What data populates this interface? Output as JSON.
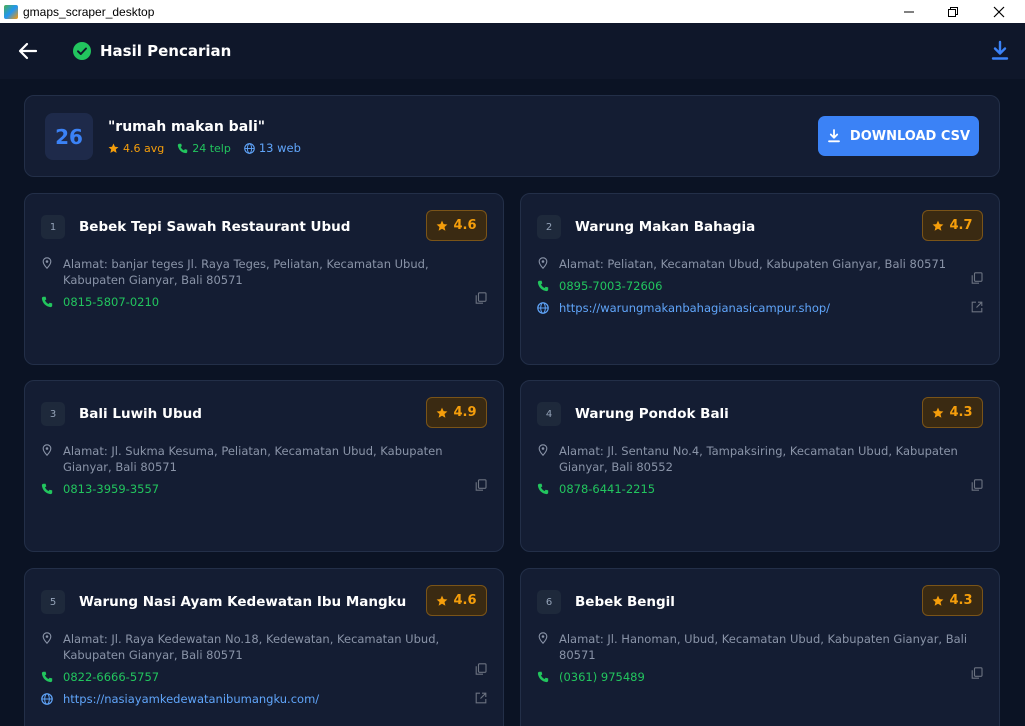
{
  "window": {
    "title": "gmaps_scraper_desktop"
  },
  "header": {
    "title": "Hasil Pencarian"
  },
  "summary": {
    "count": "26",
    "query": "\"rumah makan bali\"",
    "avg": "4.6 avg",
    "telp": "24 telp",
    "web": "13 web",
    "download_label": "DOWNLOAD CSV"
  },
  "results": [
    {
      "index": "1",
      "name": "Bebek Tepi Sawah Restaurant Ubud",
      "rating": "4.6",
      "address": "Alamat: banjar teges Jl. Raya Teges, Peliatan, Kecamatan Ubud, Kabupaten Gianyar, Bali 80571",
      "phone": "0815-5807-0210",
      "website": ""
    },
    {
      "index": "2",
      "name": "Warung Makan Bahagia",
      "rating": "4.7",
      "address": "Alamat: Peliatan, Kecamatan Ubud, Kabupaten Gianyar, Bali 80571",
      "phone": "0895-7003-72606",
      "website": "https://warungmakanbahagianasicampur.shop/"
    },
    {
      "index": "3",
      "name": "Bali Luwih Ubud",
      "rating": "4.9",
      "address": "Alamat: Jl. Sukma Kesuma, Peliatan, Kecamatan Ubud, Kabupaten Gianyar, Bali 80571",
      "phone": "0813-3959-3557",
      "website": ""
    },
    {
      "index": "4",
      "name": "Warung Pondok Bali",
      "rating": "4.3",
      "address": "Alamat: Jl. Sentanu No.4, Tampaksiring, Kecamatan Ubud, Kabupaten Gianyar, Bali 80552",
      "phone": "0878-6441-2215",
      "website": ""
    },
    {
      "index": "5",
      "name": "Warung Nasi Ayam Kedewatan Ibu Mangku",
      "rating": "4.6",
      "address": "Alamat: Jl. Raya Kedewatan No.18, Kedewatan, Kecamatan Ubud, Kabupaten Gianyar, Bali 80571",
      "phone": "0822-6666-5757",
      "website": "https://nasiayamkedewatanibumangku.com/"
    },
    {
      "index": "6",
      "name": "Bebek Bengil",
      "rating": "4.3",
      "address": "Alamat: Jl. Hanoman, Ubud, Kecamatan Ubud, Kabupaten Gianyar, Bali 80571",
      "phone": "(0361) 975489",
      "website": ""
    }
  ],
  "colors": {
    "background": "#0b1324",
    "card": "#141d33",
    "accent": "#3b82f6",
    "rating": "#f59e0b",
    "phone": "#22c55e",
    "link": "#60a5fa"
  }
}
